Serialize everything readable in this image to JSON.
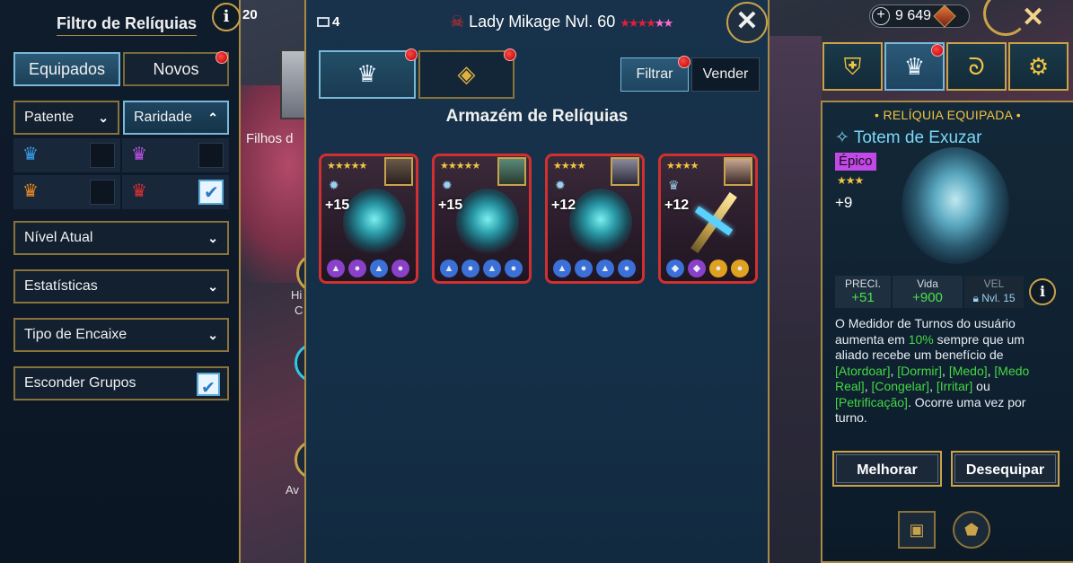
{
  "background": {
    "player_level": "20",
    "clan_label": "Filhos d",
    "side_labels": [
      "Hi",
      "C",
      "Av"
    ]
  },
  "topbar": {
    "currency_amount": "9 649",
    "close_symbol": "✕"
  },
  "filter": {
    "title": "Filtro de Relíquias",
    "info": "i",
    "tabs": {
      "equipped": "Equipados",
      "new": "Novos"
    },
    "rank_dropdown": "Patente",
    "rarity_dropdown": "Raridade",
    "rarity_options": [
      {
        "icon": "blue-crown-icon",
        "color": "#3aa0f0",
        "checked": false
      },
      {
        "icon": "purple-crown-icon",
        "color": "#c050e8",
        "checked": false
      },
      {
        "icon": "orange-crown-icon",
        "color": "#f08a20",
        "checked": false
      },
      {
        "icon": "red-crown-icon",
        "color": "#e03030",
        "checked": true
      }
    ],
    "sections": [
      "Nível Atual",
      "Estatísticas",
      "Tipo de Encaixe"
    ],
    "hide_sets": {
      "label": "Esconder Grupos",
      "checked": true
    }
  },
  "storage": {
    "count": "4",
    "boss_name": "Lady Mikage Nvl. 60",
    "boss_stars": 6,
    "title": "Armazém de Relíquias",
    "filter_button": "Filtrar",
    "sell_button": "Vender",
    "relics": [
      {
        "stars": "★★★★★",
        "level": "+15",
        "stats": [
          {
            "s": "▲",
            "c": "#8a40c8"
          },
          {
            "s": "●",
            "c": "#8a40c8"
          },
          {
            "s": "▲",
            "c": "#3a70d8"
          },
          {
            "s": "●",
            "c": "#8a40c8"
          }
        ]
      },
      {
        "stars": "★★★★★",
        "level": "+15",
        "stats": [
          {
            "s": "▲",
            "c": "#3a70d8"
          },
          {
            "s": "●",
            "c": "#3a70d8"
          },
          {
            "s": "▲",
            "c": "#3a70d8"
          },
          {
            "s": "●",
            "c": "#3a70d8"
          }
        ]
      },
      {
        "stars": "★★★★",
        "level": "+12",
        "stats": [
          {
            "s": "▲",
            "c": "#3a70d8"
          },
          {
            "s": "●",
            "c": "#3a70d8"
          },
          {
            "s": "▲",
            "c": "#3a70d8"
          },
          {
            "s": "●",
            "c": "#3a70d8"
          }
        ]
      },
      {
        "stars": "★★★★",
        "level": "+12",
        "stats": [
          {
            "s": "◆",
            "c": "#3a70d8"
          },
          {
            "s": "◆",
            "c": "#8a40c8"
          },
          {
            "s": "●",
            "c": "#e0a020"
          },
          {
            "s": "●",
            "c": "#e0a020"
          }
        ]
      }
    ]
  },
  "equipped": {
    "header": "• RELÍQUIA EQUIPADA •",
    "name": "Totem de Exuzar",
    "rarity": "Épico",
    "stars": "★★★",
    "level": "+9",
    "stats": [
      {
        "label": "PRECI.",
        "value": "+51"
      },
      {
        "label": "Vida",
        "value": "+900"
      },
      {
        "label": "VEL",
        "value": "Nvl. 15"
      }
    ],
    "info": "i",
    "description": {
      "p1": "O Medidor de Turnos do usuário aumenta em ",
      "pct": "10%",
      "p2": " sempre que um aliado recebe um benefício de ",
      "e1": "[Atordoar]",
      "e2": "[Dormir]",
      "e3": "[Medo]",
      "e4": "[Medo Real]",
      "e5": "[Congelar]",
      "e6": "[Irritar]",
      "or": " ou ",
      "e7": "[Petrificação]",
      "p3": ". Ocorre uma vez por turno."
    },
    "upgrade_button": "Melhorar",
    "unequip_button": "Desequipar"
  }
}
